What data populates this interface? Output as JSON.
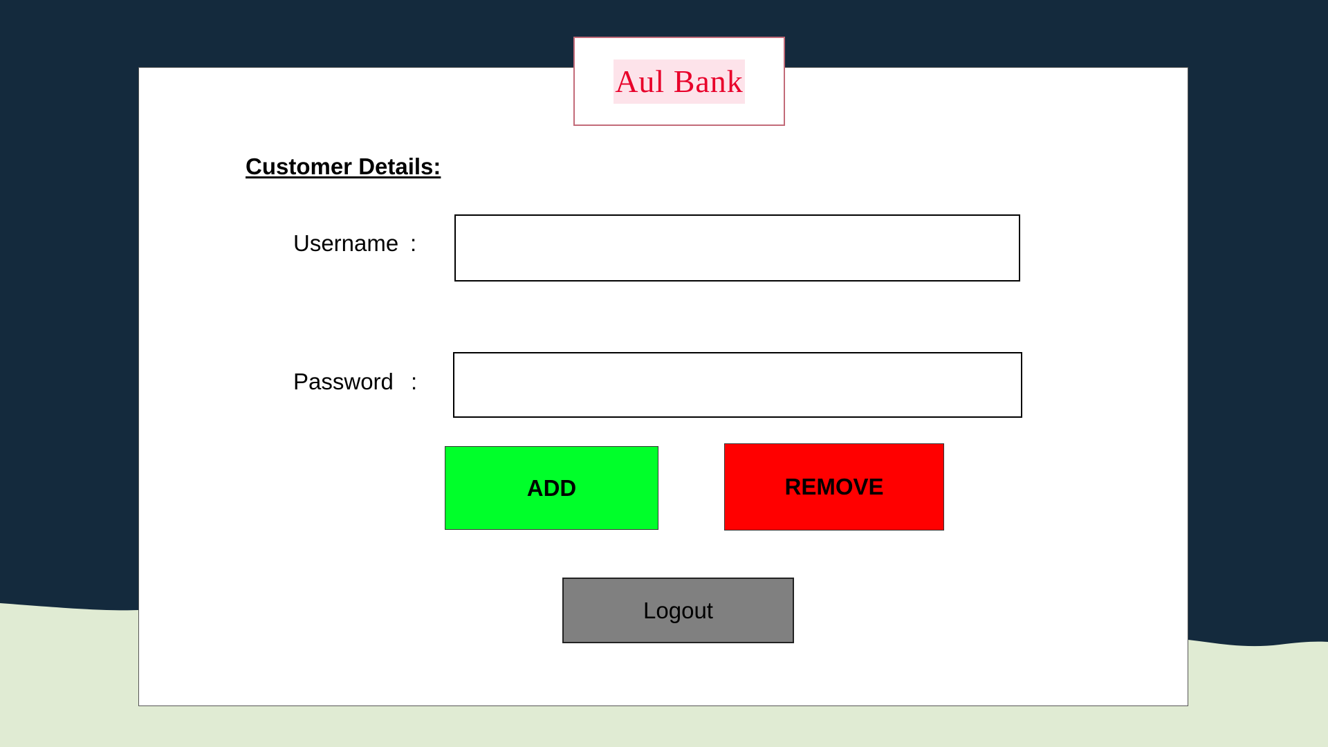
{
  "logo": {
    "text": "Aul Bank"
  },
  "form": {
    "title": "Customer Details:",
    "username": {
      "label": "Username",
      "value": "",
      "placeholder": ""
    },
    "password": {
      "label": "Password",
      "value": "",
      "placeholder": ""
    },
    "colon": ":"
  },
  "buttons": {
    "add_label": "ADD",
    "remove_label": "REMOVE",
    "logout_label": "Logout"
  },
  "colors": {
    "background_dark": "#142a3d",
    "background_light": "#e0ebd3",
    "add_button": "#00ff2a",
    "remove_button": "#ff0000",
    "logout_button": "#808080",
    "logo_text": "#e8002a",
    "logo_highlight": "#fde3ea"
  }
}
